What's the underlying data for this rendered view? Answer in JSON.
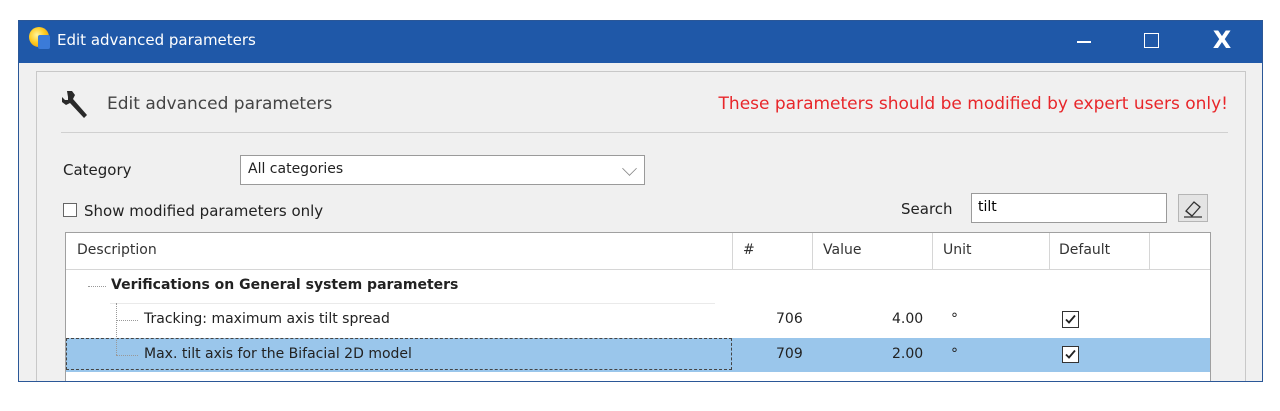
{
  "window": {
    "title": "Edit advanced parameters",
    "minimize_label": "—",
    "close_label": "X"
  },
  "header": {
    "title": "Edit advanced parameters",
    "warning": "These parameters should be modified by expert users only!"
  },
  "filters": {
    "category_label": "Category",
    "category_value": "All categories",
    "show_modified_label": "Show modified parameters only",
    "search_label": "Search",
    "search_value": "tilt"
  },
  "table": {
    "columns": {
      "description": "Description",
      "number": "#",
      "value": "Value",
      "unit": "Unit",
      "default": "Default"
    },
    "group": {
      "label": "Verifications on General system parameters"
    },
    "rows": [
      {
        "description": "Tracking: maximum axis tilt spread",
        "number": "706",
        "value": "4.00",
        "unit": "°",
        "default": true
      },
      {
        "description": "Max. tilt axis for the Bifacial 2D model",
        "number": "709",
        "value": "2.00",
        "unit": "°",
        "default": true,
        "selected": true
      }
    ]
  },
  "colors": {
    "titlebar": "#1f58a8",
    "warning": "#e8262a",
    "selection": "#9ac6eb"
  },
  "icons": {
    "app": "app-logo-icon",
    "header": "wrench-icon",
    "eraser": "eraser-icon",
    "dropdown": "chevron-down-icon",
    "checkbox": "checkbox-icon"
  }
}
